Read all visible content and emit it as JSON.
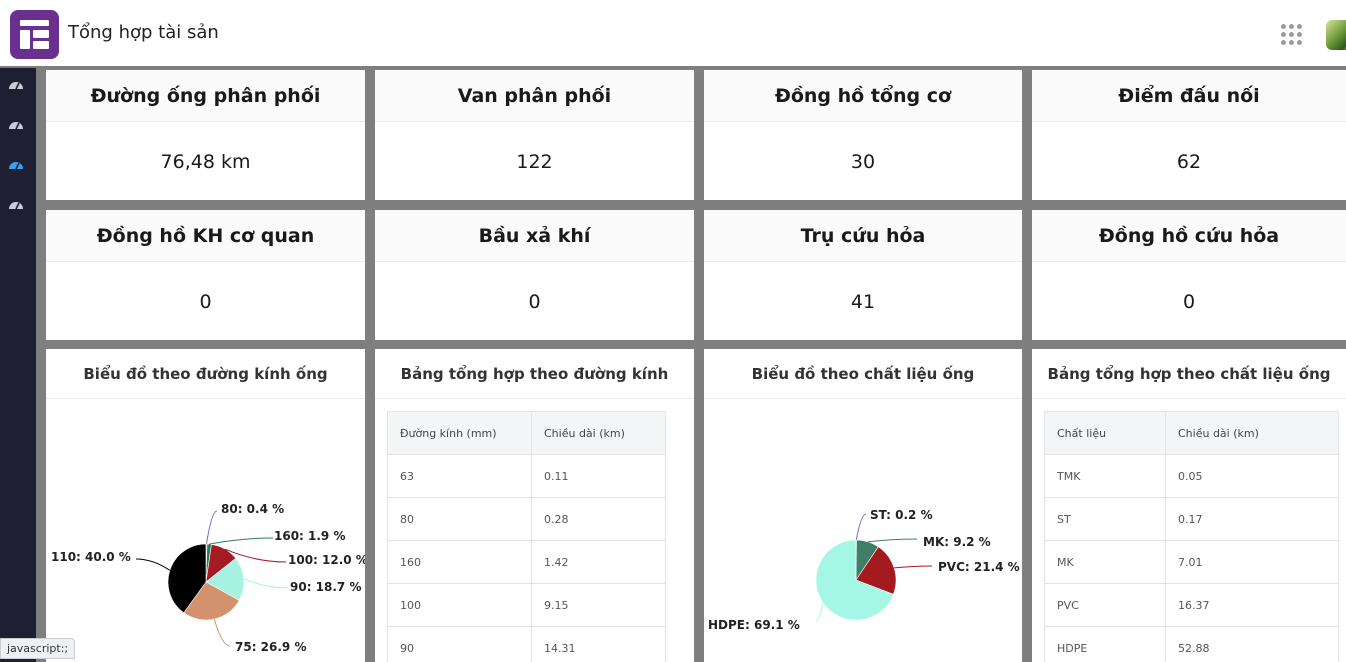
{
  "header": {
    "title": "Tổng hợp tài sản"
  },
  "summary_cards": [
    {
      "title": "Đường ống phân phối",
      "value": "76,48 km"
    },
    {
      "title": "Van phân phối",
      "value": "122"
    },
    {
      "title": "Đồng hồ tổng cơ",
      "value": "30"
    },
    {
      "title": "Điểm đấu nối",
      "value": "62"
    },
    {
      "title": "Đồng hồ KH cơ quan",
      "value": "0"
    },
    {
      "title": "Bầu xả khí",
      "value": "0"
    },
    {
      "title": "Trụ cứu hỏa",
      "value": "41"
    },
    {
      "title": "Đồng hồ cứu hỏa",
      "value": "0"
    }
  ],
  "panels": {
    "diameter_chart_title": "Biểu đồ theo đường kính ống",
    "diameter_table_title": "Bảng tổng hợp theo đường kính",
    "material_chart_title": "Biểu đồ theo chất liệu ống",
    "material_table_title": "Bảng  tổng hợp theo chất liệu ống"
  },
  "diameter_table": {
    "headers": [
      "Đường kính (mm)",
      "Chiều dài (km)"
    ],
    "rows": [
      [
        "63",
        "0.11"
      ],
      [
        "80",
        "0.28"
      ],
      [
        "160",
        "1.42"
      ],
      [
        "100",
        "9.15"
      ],
      [
        "90",
        "14.31"
      ]
    ]
  },
  "material_table": {
    "headers": [
      "Chất liệu",
      "Chiều dài (km)"
    ],
    "rows": [
      [
        "TMK",
        "0.05"
      ],
      [
        "ST",
        "0.17"
      ],
      [
        "MK",
        "7.01"
      ],
      [
        "PVC",
        "16.37"
      ],
      [
        "HDPE",
        "52.88"
      ]
    ]
  },
  "chart_data": [
    {
      "type": "pie",
      "categories": [
        "80",
        "160",
        "100",
        "90",
        "75",
        "110"
      ],
      "values": [
        0.4,
        1.9,
        12.0,
        18.7,
        26.9,
        40.0
      ],
      "labels": [
        "80: 0.4 %",
        "160: 1.9 %",
        "100: 12.0 %",
        "90: 18.7 %",
        "75: 26.9 %",
        "110: 40.0 %"
      ],
      "colors": [
        "#6d6dd0",
        "#2f7a62",
        "#a61b22",
        "#a7f2e0",
        "#d4916d",
        "#000000"
      ]
    },
    {
      "type": "pie",
      "categories": [
        "ST",
        "MK",
        "PVC",
        "HDPE"
      ],
      "values": [
        0.2,
        9.2,
        21.4,
        69.1
      ],
      "labels": [
        "ST: 0.2 %",
        "MK: 9.2 %",
        "PVC: 21.4 %",
        "HDPE: 69.1 %"
      ],
      "colors": [
        "#6d6dd0",
        "#3f7f68",
        "#a31b1e",
        "#a4f7e4"
      ]
    }
  ],
  "status_bar": {
    "text": "javascript:;"
  }
}
